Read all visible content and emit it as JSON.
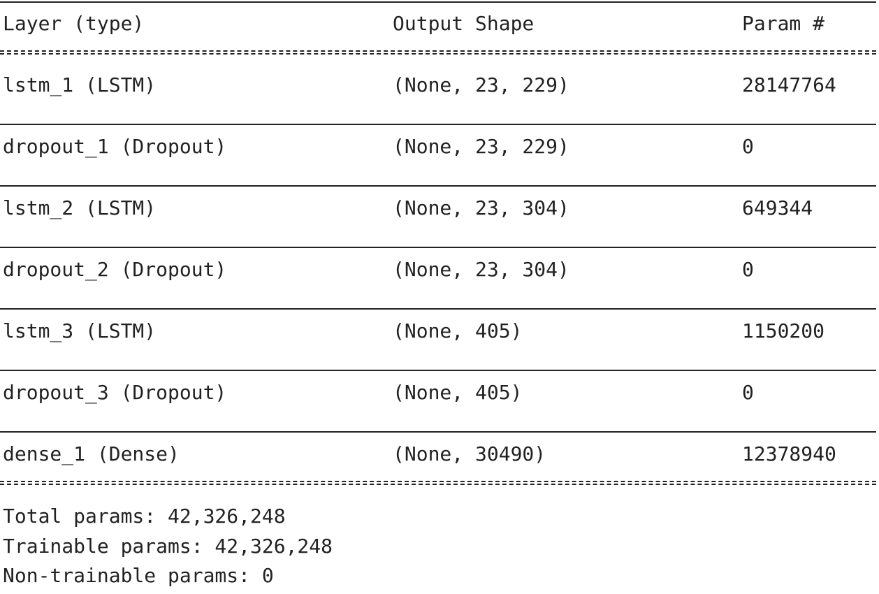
{
  "header": {
    "layer_type": "Layer (type)",
    "output_shape": "Output Shape",
    "param_count": "Param #"
  },
  "layers": [
    {
      "name": "lstm_1 (LSTM)",
      "shape": "(None, 23, 229)",
      "params": "28147764"
    },
    {
      "name": "dropout_1 (Dropout)",
      "shape": "(None, 23, 229)",
      "params": "0"
    },
    {
      "name": "lstm_2 (LSTM)",
      "shape": "(None, 23, 304)",
      "params": "649344"
    },
    {
      "name": "dropout_2 (Dropout)",
      "shape": "(None, 23, 304)",
      "params": "0"
    },
    {
      "name": "lstm_3 (LSTM)",
      "shape": "(None, 405)",
      "params": "1150200"
    },
    {
      "name": "dropout_3 (Dropout)",
      "shape": "(None, 405)",
      "params": "0"
    },
    {
      "name": "dense_1 (Dense)",
      "shape": "(None, 30490)",
      "params": "12378940"
    }
  ],
  "totals": {
    "total": "Total params: 42,326,248",
    "trainable": "Trainable params: 42,326,248",
    "non_trainable": "Non-trainable params: 0"
  }
}
